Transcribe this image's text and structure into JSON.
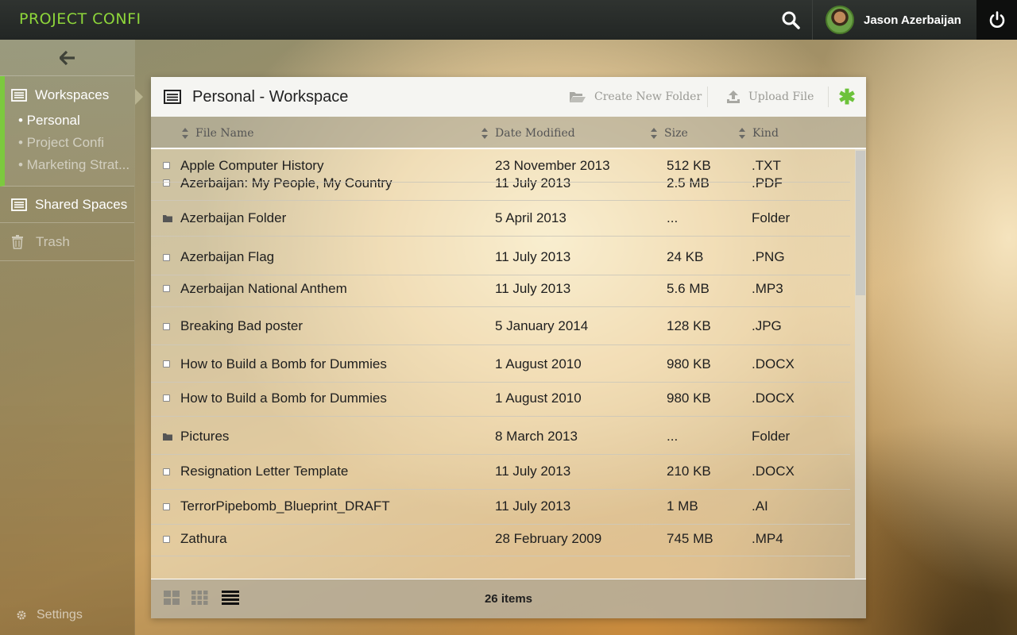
{
  "app": {
    "brand": "PROJECT CONFI"
  },
  "user": {
    "name": "Jason Azerbaijan"
  },
  "sidebar": {
    "workspaces_label": "Workspaces",
    "workspaces": [
      {
        "label": "• Personal"
      },
      {
        "label": "• Project Confi"
      },
      {
        "label": "• Marketing Strat..."
      }
    ],
    "shared_label": "Shared Spaces",
    "trash_label": "Trash",
    "settings_label": "Settings"
  },
  "panel": {
    "title": "Personal - Workspace",
    "create_folder_label": "Create New Folder",
    "upload_label": "Upload File",
    "columns": {
      "name": "File Name",
      "date": "Date Modified",
      "size": "Size",
      "kind": "Kind"
    },
    "files": [
      {
        "type": "file",
        "name": "Apple Computer History",
        "date": "23 November 2013",
        "size": "512 KB",
        "kind": ".TXT"
      },
      {
        "type": "file",
        "name": "Azerbaijan: My People, My Country",
        "date": "11 July 2013",
        "size": "2.5 MB",
        "kind": ".PDF"
      },
      {
        "type": "folder",
        "name": "Azerbaijan Folder",
        "date": "5 April 2013",
        "size": "...",
        "kind": "Folder"
      },
      {
        "type": "file",
        "name": "Azerbaijan Flag",
        "date": "11 July 2013",
        "size": "24 KB",
        "kind": ".PNG"
      },
      {
        "type": "file",
        "name": "Azerbaijan National Anthem",
        "date": "11 July 2013",
        "size": "5.6 MB",
        "kind": ".MP3"
      },
      {
        "type": "file",
        "name": "Breaking Bad poster",
        "date": "5 January 2014",
        "size": "128 KB",
        "kind": ".JPG"
      },
      {
        "type": "file",
        "name": "How to Build a Bomb for Dummies",
        "date": "1 August 2010",
        "size": "980 KB",
        "kind": ".DOCX"
      },
      {
        "type": "file",
        "name": "How to Build a Bomb for Dummies",
        "date": "1 August 2010",
        "size": "980 KB",
        "kind": ".DOCX"
      },
      {
        "type": "folder",
        "name": "Pictures",
        "date": "8 March 2013",
        "size": "...",
        "kind": "Folder"
      },
      {
        "type": "file",
        "name": "Resignation Letter Template",
        "date": "11 July 2013",
        "size": "210 KB",
        "kind": ".DOCX"
      },
      {
        "type": "file",
        "name": "TerrorPipebomb_Blueprint_DRAFT",
        "date": "11 July 2013",
        "size": "1 MB",
        "kind": ".AI"
      },
      {
        "type": "file",
        "name": "Zathura",
        "date": "28 February 2009",
        "size": "745 MB",
        "kind": ".MP4"
      }
    ],
    "items_count": "26 items"
  },
  "colors": {
    "accent": "#7cc93e",
    "topbar": "#262a27"
  },
  "icons": [
    "search-icon",
    "power-icon",
    "back-arrow-icon",
    "list-icon",
    "trash-icon",
    "gear-icon",
    "folder-open-icon",
    "upload-icon",
    "asterisk-icon",
    "sort-icon",
    "checkbox-icon",
    "folder-icon",
    "large-grid-icon",
    "small-grid-icon",
    "list-view-icon"
  ]
}
